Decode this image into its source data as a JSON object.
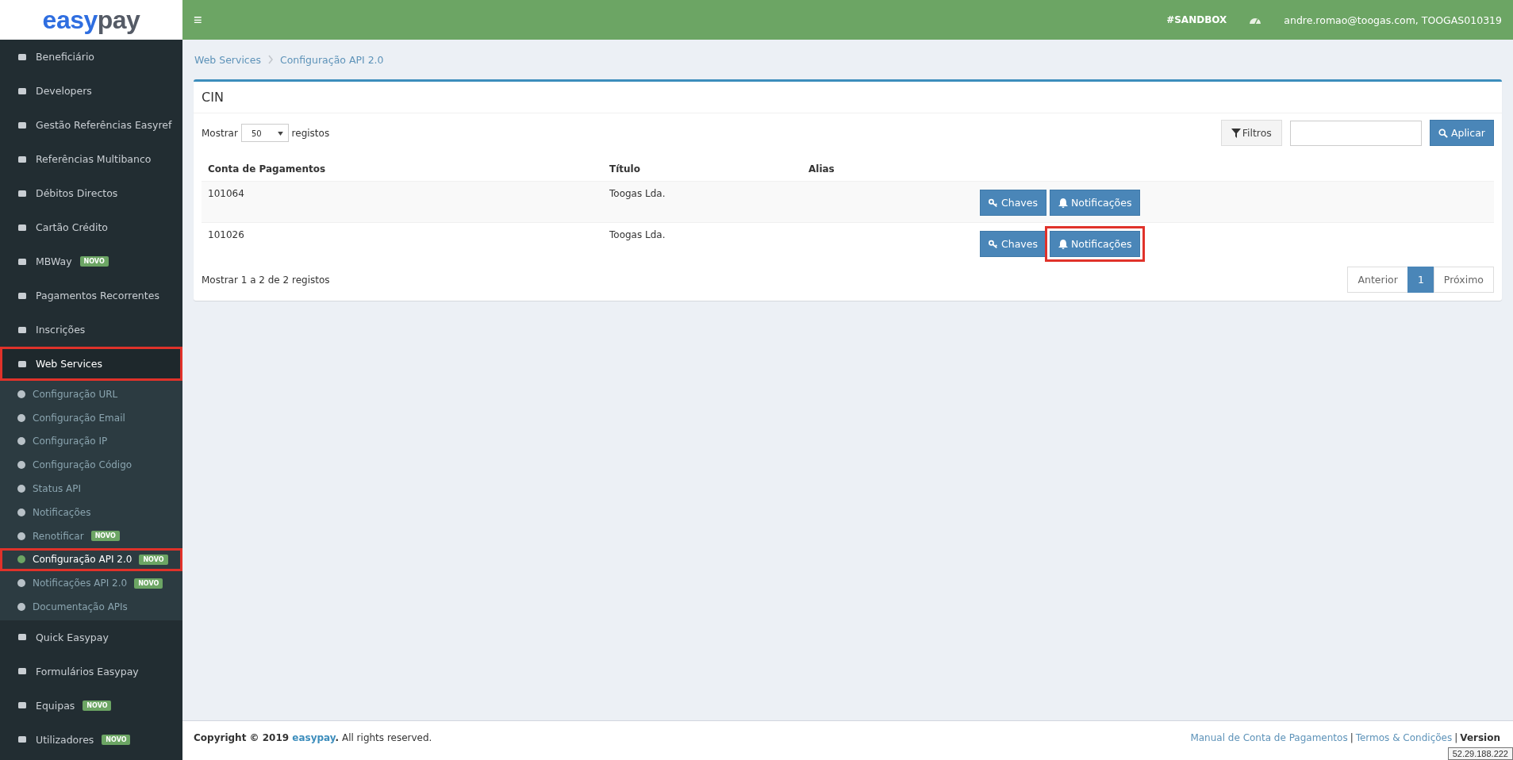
{
  "logo": {
    "part_1": "easy",
    "part_2": "pay"
  },
  "topbar": {
    "menu_glyph": "≡",
    "env": "#SANDBOX",
    "user": "andre.romao@toogas.com, TOOGAS010319"
  },
  "sidebar": {
    "items": [
      {
        "label": "Beneficiário",
        "selected": false
      },
      {
        "label": "Developers",
        "selected": false
      },
      {
        "label": "Gestão Referências Easyref",
        "selected": false
      },
      {
        "label": "Referências Multibanco",
        "selected": false
      },
      {
        "label": "Débitos Directos",
        "selected": false
      },
      {
        "label": "Cartão Crédito",
        "selected": false
      },
      {
        "label": "MBWay",
        "badge": "NOVO",
        "selected": false
      },
      {
        "label": "Pagamentos Recorrentes",
        "selected": false
      },
      {
        "label": "Inscrições",
        "selected": false
      },
      {
        "label": "Web Services",
        "selected": true,
        "highlighted": true,
        "expanded": true,
        "children": [
          {
            "label": "Configuração URL",
            "selected": false
          },
          {
            "label": "Configuração Email",
            "selected": false
          },
          {
            "label": "Configuração IP",
            "selected": false
          },
          {
            "label": "Configuração Código",
            "selected": false
          },
          {
            "label": "Status API",
            "selected": false
          },
          {
            "label": "Notificações",
            "selected": false
          },
          {
            "label": "Renotificar",
            "badge": "NOVO",
            "selected": false
          },
          {
            "label": "Configuração API 2.0",
            "badge": "NOVO",
            "selected": true,
            "highlighted": true
          },
          {
            "label": "Notificações API 2.0",
            "badge": "NOVO",
            "selected": false
          },
          {
            "label": "Documentação APIs",
            "selected": false
          }
        ]
      },
      {
        "label": "Quick Easypay",
        "selected": false
      },
      {
        "label": "Formulários Easypay",
        "selected": false
      },
      {
        "label": "Equipas",
        "badge": "NOVO",
        "selected": false
      },
      {
        "label": "Utilizadores",
        "badge": "NOVO",
        "selected": false
      }
    ]
  },
  "breadcrumb": [
    "Web Services",
    "Configuração API 2.0"
  ],
  "panel": {
    "title": "CIN",
    "length_prefix": "Mostrar",
    "length_value": "50",
    "length_suffix": "registos",
    "filter_button": "Filtros",
    "apply_button": "Aplicar",
    "table": {
      "columns": [
        "Conta de Pagamentos",
        "Título",
        "Alias"
      ],
      "rows": [
        {
          "account": "101064",
          "title": "Toogas Lda.",
          "buttons": [
            {
              "label": "Chaves",
              "highlighted": false
            },
            {
              "label": "Notificações",
              "highlighted": false
            }
          ]
        },
        {
          "account": "101026",
          "title": "Toogas Lda.",
          "buttons": [
            {
              "label": "Chaves",
              "highlighted": false
            },
            {
              "label": "Notificações",
              "highlighted": true
            }
          ]
        }
      ]
    },
    "info": "Mostrar 1 a 2 de 2 registos",
    "pagination": [
      {
        "label": "Anterior",
        "selected": false
      },
      {
        "label": "1",
        "selected": true
      },
      {
        "label": "Próximo",
        "selected": false
      }
    ]
  },
  "footer": {
    "copyright_prefix": "Copyright © 2019",
    "brand": "easypay",
    "copyright_dot": ".",
    "copyright_suffix": "All rights reserved.",
    "links": [
      "Manual de Conta de Pagamentos",
      "Termos & Condições"
    ],
    "separator": "|",
    "version": "Version",
    "ip_tooltip": "52.29.188.222"
  }
}
